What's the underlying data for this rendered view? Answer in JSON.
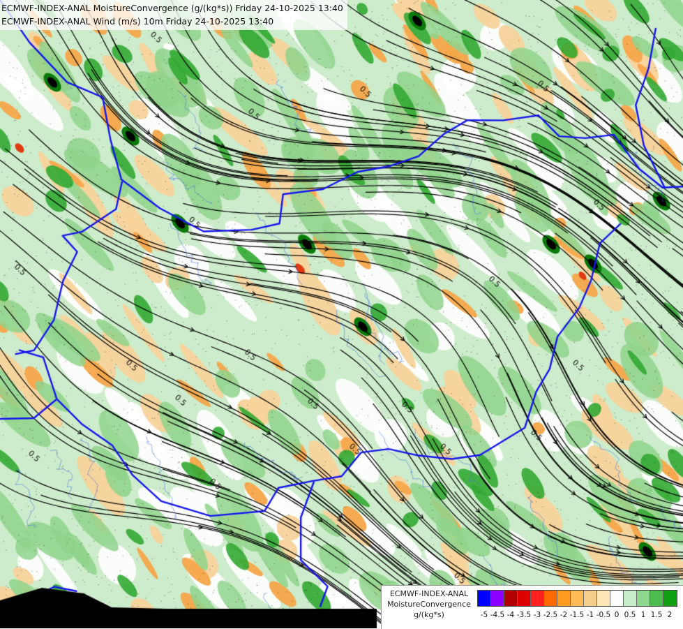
{
  "title": {
    "line1": "ECMWF-INDEX-ANAL MoistureConvergence (g/(kg*s)) Friday 24-10-2025 13:40",
    "line2": "ECMWF-INDEX-ANAL Wind (m/s) 10m Friday 24-10-2025 13:40"
  },
  "legend": {
    "line1": "ECMWF-INDEX-ANAL",
    "line2": "MoistureConvergence",
    "line3": "g/(kg*s)",
    "ticks": [
      "-5",
      "-4.5",
      "-4",
      "-3.5",
      "-3",
      "-2.5",
      "-2",
      "-1.5",
      "-1",
      "-0.5",
      "0",
      "0.5",
      "1",
      "1.5",
      "2"
    ],
    "colors": [
      "#0000ff",
      "#8b00ff",
      "#b00000",
      "#dd0000",
      "#ff2020",
      "#ff6a00",
      "#ff9a20",
      "#ffbb55",
      "#f5cf8a",
      "#ffe8b8",
      "#ffffff",
      "#c8ecc8",
      "#8fd88f",
      "#4cbc4c",
      "#10a010"
    ]
  },
  "contour_label": "0.5",
  "colors": {
    "land_green_light": "#cdeccb",
    "land_green_mid": "#8fd38c",
    "land_green_dark": "#33aa33",
    "convergence_core": "#0a7a0a",
    "divergence_orange": "#f5a64a",
    "divergence_light": "#f8d39b",
    "border_blue": "#1515ee",
    "river_blue": "#3f6fe0",
    "streamline": "#000000"
  }
}
